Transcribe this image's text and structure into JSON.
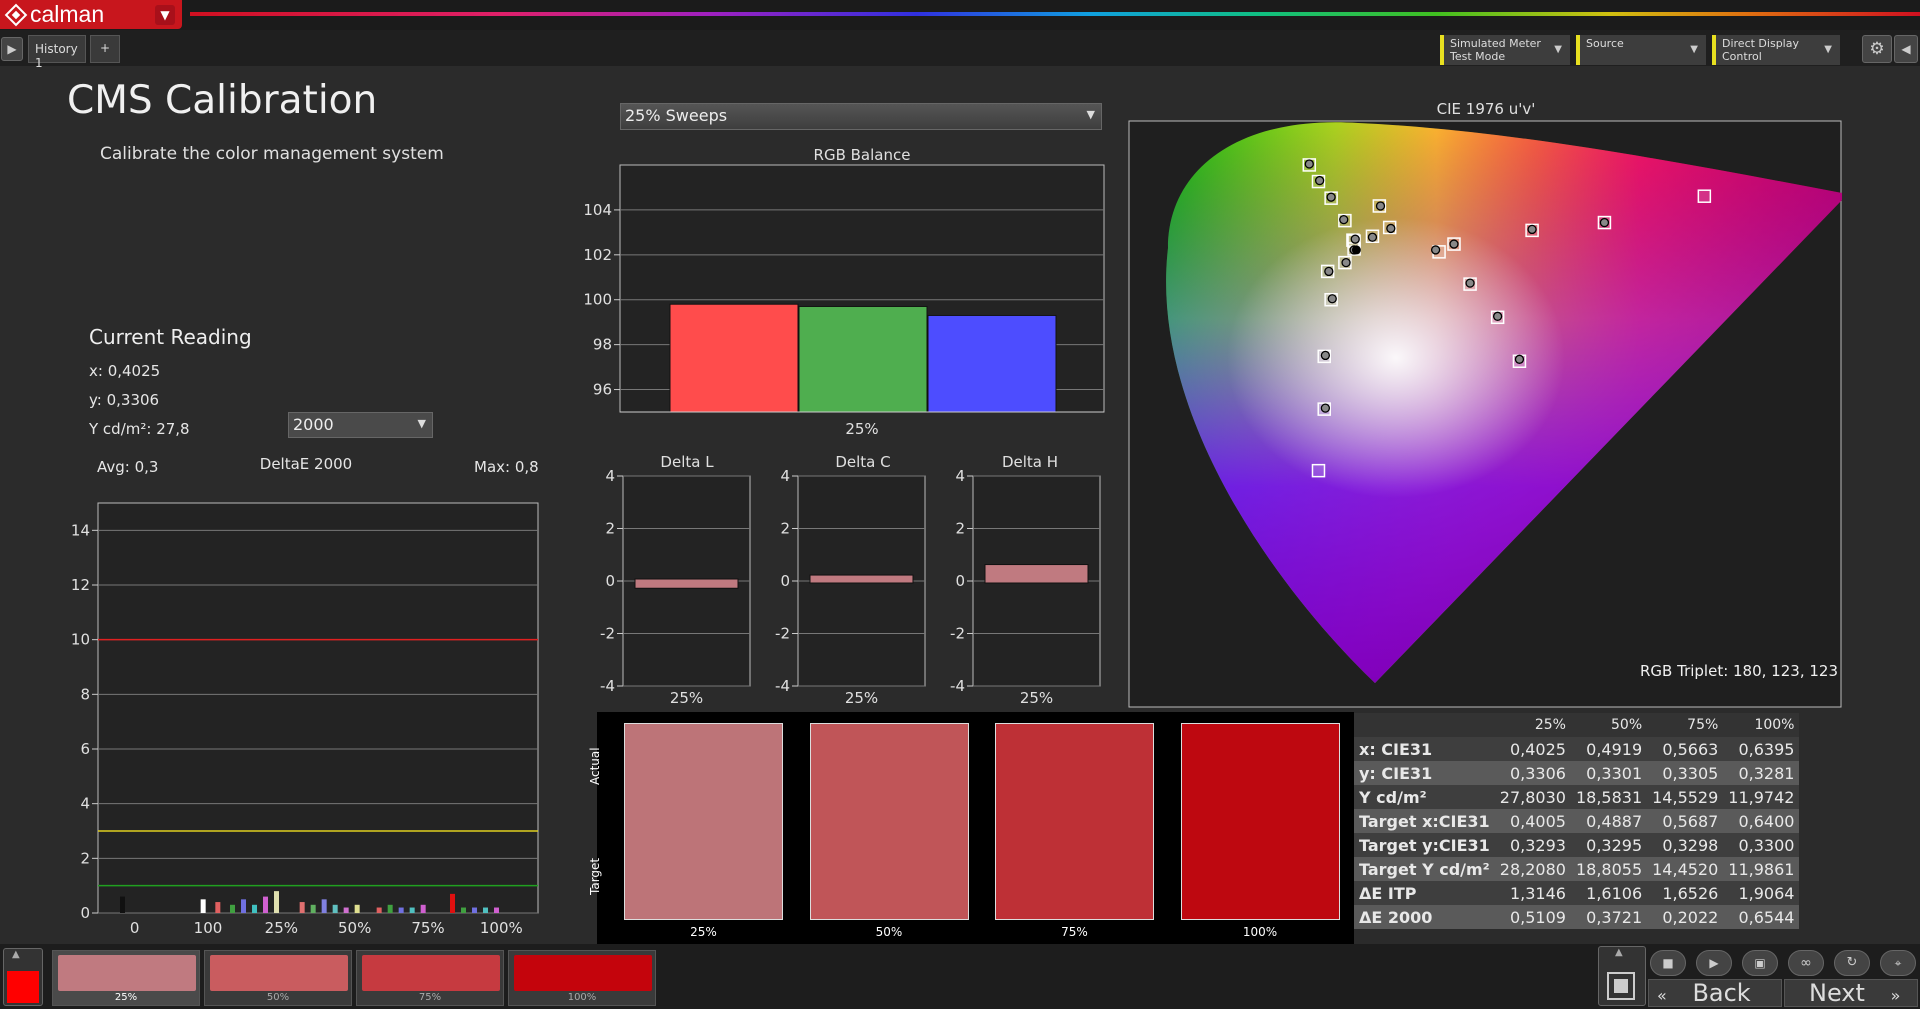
{
  "app": {
    "name": "calman",
    "logo_icon": "calman-diamond-logo-icon"
  },
  "tabs": [
    {
      "label": "History 1"
    }
  ],
  "toolbar": {
    "meter": {
      "line1": "Simulated Meter",
      "line2": "Test Mode"
    },
    "source": {
      "label": "Source"
    },
    "display": {
      "label": "Direct Display Control"
    }
  },
  "page": {
    "title": "CMS Calibration",
    "subtitle": "Calibrate the color management system"
  },
  "current_reading": {
    "heading": "Current Reading",
    "x": "x: 0,4025",
    "y": "y: 0,3306",
    "Y": "Y cd/m²: 27,8",
    "de_select": "2000"
  },
  "sweep_select": "25% Sweeps",
  "colors": {
    "accent_red": "#c8161d",
    "meter_yellow": "#e8e020"
  },
  "chart_data": [
    {
      "id": "deltae",
      "type": "bar",
      "title": "DeltaE 2000",
      "avg_label": "Avg: 0,3",
      "max_label": "Max: 0,8",
      "ylim": [
        0,
        15
      ],
      "yticks": [
        0,
        2,
        4,
        6,
        8,
        10,
        12,
        14
      ],
      "xticks": [
        "0",
        "100",
        "25%",
        "50%",
        "75%",
        "100%"
      ],
      "threshold_lines": [
        {
          "value": 10,
          "color": "#e02020"
        },
        {
          "value": 3,
          "color": "#e0d020"
        },
        {
          "value": 1,
          "color": "#20a020"
        }
      ],
      "bars": [
        {
          "x": 0.3,
          "value": 0.6,
          "color": "#111111"
        },
        {
          "x": 1.4,
          "value": 0.5,
          "color": "#ffffff"
        },
        {
          "x": 1.6,
          "value": 0.4,
          "color": "#e06060"
        },
        {
          "x": 1.8,
          "value": 0.3,
          "color": "#40a040"
        },
        {
          "x": 1.95,
          "value": 0.5,
          "color": "#7070e0"
        },
        {
          "x": 2.1,
          "value": 0.3,
          "color": "#40c0c0"
        },
        {
          "x": 2.25,
          "value": 0.6,
          "color": "#d060d0"
        },
        {
          "x": 2.4,
          "value": 0.8,
          "color": "#e0e0b0"
        },
        {
          "x": 2.75,
          "value": 0.4,
          "color": "#e07070"
        },
        {
          "x": 2.9,
          "value": 0.3,
          "color": "#60b060"
        },
        {
          "x": 3.05,
          "value": 0.5,
          "color": "#8080e0"
        },
        {
          "x": 3.2,
          "value": 0.3,
          "color": "#60c0c0"
        },
        {
          "x": 3.35,
          "value": 0.2,
          "color": "#d070d0"
        },
        {
          "x": 3.5,
          "value": 0.3,
          "color": "#e0e090"
        },
        {
          "x": 3.8,
          "value": 0.2,
          "color": "#e06060"
        },
        {
          "x": 3.95,
          "value": 0.3,
          "color": "#40a040"
        },
        {
          "x": 4.1,
          "value": 0.2,
          "color": "#7070e0"
        },
        {
          "x": 4.25,
          "value": 0.2,
          "color": "#50c0c0"
        },
        {
          "x": 4.4,
          "value": 0.3,
          "color": "#d060d0"
        },
        {
          "x": 4.8,
          "value": 0.7,
          "color": "#e01010"
        },
        {
          "x": 4.95,
          "value": 0.2,
          "color": "#40a040"
        },
        {
          "x": 5.1,
          "value": 0.2,
          "color": "#7070e0"
        },
        {
          "x": 5.25,
          "value": 0.2,
          "color": "#50c0c0"
        },
        {
          "x": 5.4,
          "value": 0.2,
          "color": "#d060d0"
        }
      ]
    },
    {
      "id": "rgb",
      "type": "bar",
      "title": "RGB Balance",
      "categories": [
        "R",
        "G",
        "B"
      ],
      "values": [
        99.8,
        99.7,
        99.3
      ],
      "colors": [
        "#ff4c4c",
        "#4fae4f",
        "#4d4dff"
      ],
      "ylim": [
        95,
        106
      ],
      "yticks": [
        96,
        98,
        100,
        102,
        104
      ],
      "xlabel": "25%"
    },
    {
      "id": "dl",
      "type": "bar",
      "title": "Delta L",
      "values": [
        -0.2
      ],
      "color": "#c07a80",
      "ylim": [
        -4,
        4
      ],
      "yticks": [
        -4,
        -2,
        0,
        2,
        4
      ],
      "xlabel": "25%"
    },
    {
      "id": "dc",
      "type": "bar",
      "title": "Delta C",
      "values": [
        0.15
      ],
      "color": "#c07a80",
      "ylim": [
        -4,
        4
      ],
      "yticks": [
        -4,
        -2,
        0,
        2,
        4
      ],
      "xlabel": "25%"
    },
    {
      "id": "dh",
      "type": "bar",
      "title": "Delta H",
      "values": [
        0.55
      ],
      "color": "#c07a80",
      "ylim": [
        -4,
        4
      ],
      "yticks": [
        -4,
        -2,
        0,
        2,
        4
      ],
      "xlabel": "25%"
    },
    {
      "id": "cie",
      "type": "scatter",
      "title": "CIE 1976 u'v'",
      "rgb_triplet": "RGB Triplet: 180, 123, 123",
      "targets": [
        [
          0.157,
          0.555
        ],
        [
          0.165,
          0.538
        ],
        [
          0.176,
          0.521
        ],
        [
          0.188,
          0.498
        ],
        [
          0.195,
          0.478
        ],
        [
          0.218,
          0.513
        ],
        [
          0.283,
          0.474
        ],
        [
          0.351,
          0.488
        ],
        [
          0.414,
          0.496
        ],
        [
          0.501,
          0.523
        ],
        [
          0.173,
          0.446
        ],
        [
          0.188,
          0.455
        ],
        [
          0.196,
          0.469
        ],
        [
          0.212,
          0.482
        ],
        [
          0.227,
          0.491
        ],
        [
          0.27,
          0.466
        ],
        [
          0.297,
          0.433
        ],
        [
          0.321,
          0.399
        ],
        [
          0.34,
          0.354
        ],
        [
          0.176,
          0.417
        ],
        [
          0.17,
          0.359
        ],
        [
          0.17,
          0.305
        ],
        [
          0.165,
          0.242
        ],
        [
          0.196,
          0.477
        ]
      ],
      "measured": [
        [
          0.157,
          0.556
        ],
        [
          0.166,
          0.539
        ],
        [
          0.176,
          0.522
        ],
        [
          0.187,
          0.499
        ],
        [
          0.197,
          0.479
        ],
        [
          0.219,
          0.513
        ],
        [
          0.283,
          0.474
        ],
        [
          0.351,
          0.489
        ],
        [
          0.414,
          0.496
        ],
        [
          0.174,
          0.446
        ],
        [
          0.189,
          0.455
        ],
        [
          0.196,
          0.468
        ],
        [
          0.212,
          0.481
        ],
        [
          0.228,
          0.49
        ],
        [
          0.267,
          0.468
        ],
        [
          0.297,
          0.434
        ],
        [
          0.321,
          0.4
        ],
        [
          0.34,
          0.356
        ],
        [
          0.177,
          0.418
        ],
        [
          0.171,
          0.36
        ],
        [
          0.171,
          0.306
        ]
      ],
      "whitepoint": [
        0.198,
        0.468
      ],
      "axes": {
        "xlim": [
          0.0,
          0.62
        ],
        "ylim": [
          0.0,
          0.6
        ]
      }
    }
  ],
  "swatches": {
    "actual_label": "Actual",
    "target_label": "Target",
    "items": [
      {
        "label": "25%",
        "color": "#bd7478"
      },
      {
        "label": "50%",
        "color": "#c05558"
      },
      {
        "label": "75%",
        "color": "#be3036"
      },
      {
        "label": "100%",
        "color": "#be0810"
      }
    ]
  },
  "table": {
    "columns": [
      "",
      "25%",
      "50%",
      "75%",
      "100%"
    ],
    "rows": [
      [
        "x: CIE31",
        "0,4025",
        "0,4919",
        "0,5663",
        "0,6395"
      ],
      [
        "y: CIE31",
        "0,3306",
        "0,3301",
        "0,3305",
        "0,3281"
      ],
      [
        "Y cd/m²",
        "27,8030",
        "18,5831",
        "14,5529",
        "11,9742"
      ],
      [
        "Target x:CIE31",
        "0,4005",
        "0,4887",
        "0,5687",
        "0,6400"
      ],
      [
        "Target y:CIE31",
        "0,3293",
        "0,3295",
        "0,3298",
        "0,3300"
      ],
      [
        "Target Y cd/m²",
        "28,2080",
        "18,8055",
        "14,4520",
        "11,9861"
      ],
      [
        "ΔE ITP",
        "1,3146",
        "1,6106",
        "1,6526",
        "1,9064"
      ],
      [
        "ΔE 2000",
        "0,5109",
        "0,3721",
        "0,2022",
        "0,6544"
      ]
    ]
  },
  "footer": {
    "back": "Back",
    "next": "Next",
    "thumbs": [
      {
        "label": "25%",
        "color": "#c07a80"
      },
      {
        "label": "50%",
        "color": "#c95c5f"
      },
      {
        "label": "75%",
        "color": "#c63a40"
      },
      {
        "label": "100%",
        "color": "#c4040c"
      }
    ],
    "current_color": "#ff0000"
  }
}
